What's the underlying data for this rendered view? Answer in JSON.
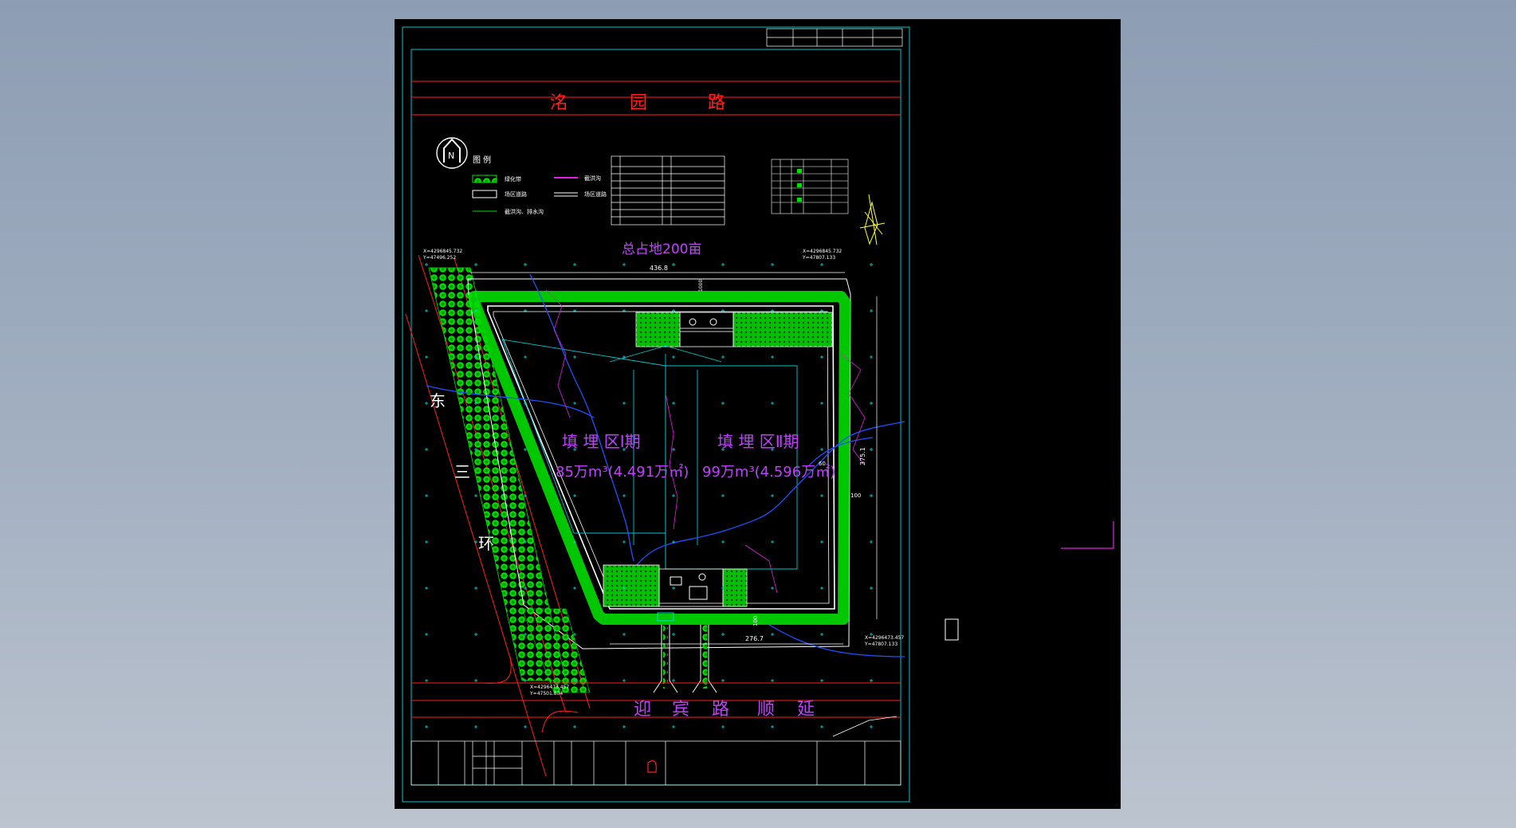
{
  "drawing": {
    "road_north": [
      "洺",
      "园",
      "路"
    ],
    "road_south": [
      "迎",
      "宾",
      "路",
      "顺",
      "延"
    ],
    "road_east": [
      "东",
      "三",
      "环"
    ],
    "total_area": "总占地200亩",
    "zone1_title": "填 埋 区Ⅰ期",
    "zone1_volume": "85万m³(4.491万㎡)",
    "zone2_title": "填 埋 区Ⅱ期",
    "zone2_volume": "99万m³(4.596万㎡)",
    "legend_title": "图 例",
    "legend_items": [
      "绿化带",
      "场区道路",
      "截洪沟、排水沟"
    ],
    "legend_lines": [
      "截洪沟",
      "场区道路"
    ],
    "dimensions": [
      "436.8",
      "276.7",
      "375.1",
      "100",
      "100",
      "60",
      "1000"
    ],
    "coord_nw": [
      "X=4296845.732",
      "Y=47496.252"
    ],
    "coord_ne": [
      "X=4296845.732",
      "Y=47807.133"
    ],
    "coord_se": [
      "X=4296473.457",
      "Y=47807.133"
    ],
    "coord_sw": [
      "X=4296473.457",
      "Y=47501.804"
    ],
    "compass": "N"
  },
  "colors": {
    "frame": "#00c8c8",
    "road_text": "#ff2020",
    "zone_text": "#c040ff",
    "green": "#00dd00",
    "blue": "#2050ff",
    "yellow": "#ffff40"
  }
}
